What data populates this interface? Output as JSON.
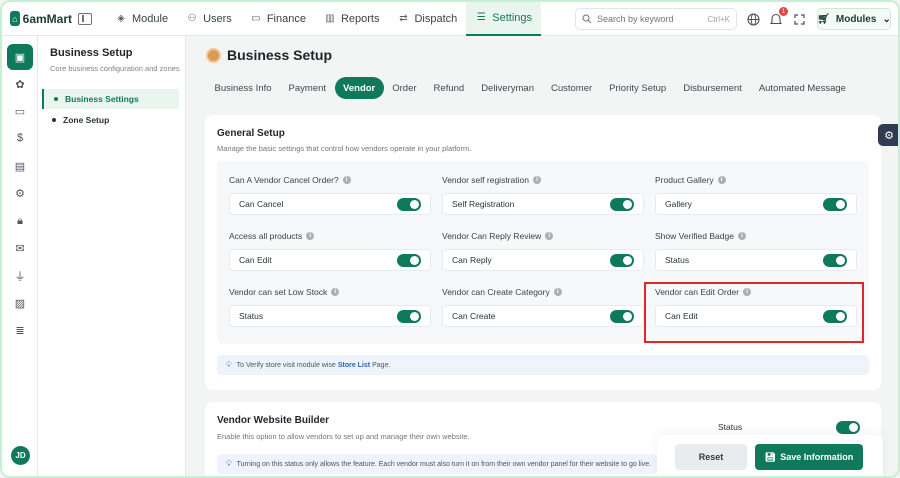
{
  "app": {
    "logo_text": "6amMart"
  },
  "topnav": {
    "items": [
      {
        "label": "Module",
        "icon": "cube-icon"
      },
      {
        "label": "Users",
        "icon": "users-icon"
      },
      {
        "label": "Finance",
        "icon": "wallet-icon"
      },
      {
        "label": "Reports",
        "icon": "bar-chart-icon"
      },
      {
        "label": "Dispatch",
        "icon": "dispatch-icon"
      },
      {
        "label": "Settings",
        "icon": "sliders-icon",
        "active": true
      }
    ],
    "search_placeholder": "Search by keyword",
    "search_shortcut": "Ctrl+K",
    "notification_count": "1",
    "modules_label": "Modules"
  },
  "sidebar": {
    "title": "Business Setup",
    "subtitle": "Core business configuration and zones",
    "items": [
      {
        "label": "Business Settings",
        "active": true
      },
      {
        "label": "Zone Setup",
        "active": false
      }
    ],
    "user_initials": "JD"
  },
  "page": {
    "title": "Business Setup",
    "tabs": [
      "Business Info",
      "Payment",
      "Vendor",
      "Order",
      "Refund",
      "Deliveryman",
      "Customer",
      "Priority Setup",
      "Disbursement",
      "Automated Message"
    ],
    "active_tab": "Vendor"
  },
  "general_setup": {
    "title": "General Setup",
    "description": "Manage the basic settings that control how vendors operate in your platform.",
    "fields": [
      {
        "label": "Can A Vendor Cancel Order?",
        "value": "Can Cancel",
        "enabled": true
      },
      {
        "label": "Vendor self registration",
        "value": "Self Registration",
        "enabled": true
      },
      {
        "label": "Product Gallery",
        "value": "Gallery",
        "enabled": true
      },
      {
        "label": "Access all products",
        "value": "Can Edit",
        "enabled": true
      },
      {
        "label": "Vendor Can Reply Review",
        "value": "Can Reply",
        "enabled": true
      },
      {
        "label": "Show Verified Badge",
        "value": "Status",
        "enabled": true
      },
      {
        "label": "Vendor can set Low Stock",
        "value": "Status",
        "enabled": true
      },
      {
        "label": "Vendor can Create Category",
        "value": "Can Create",
        "enabled": true
      },
      {
        "label": "Vendor can Edit Order",
        "value": "Can Edit",
        "enabled": true
      }
    ],
    "note_prefix": "To Verify store visit module wise",
    "note_link": "Store List",
    "note_suffix": "Page."
  },
  "website_builder": {
    "title": "Vendor Website Builder",
    "description": "Enable this option to allow vendors to set up and manage their own website.",
    "status_label": "Status",
    "status_enabled": true,
    "note": "Turning on this status only allows the feature. Each vendor must also turn it on from their own vendor panel for their website to go live."
  },
  "actions": {
    "reset_label": "Reset",
    "save_label": "Save Information"
  },
  "colors": {
    "accent": "#0f7a5b",
    "highlight": "#e0262b"
  }
}
